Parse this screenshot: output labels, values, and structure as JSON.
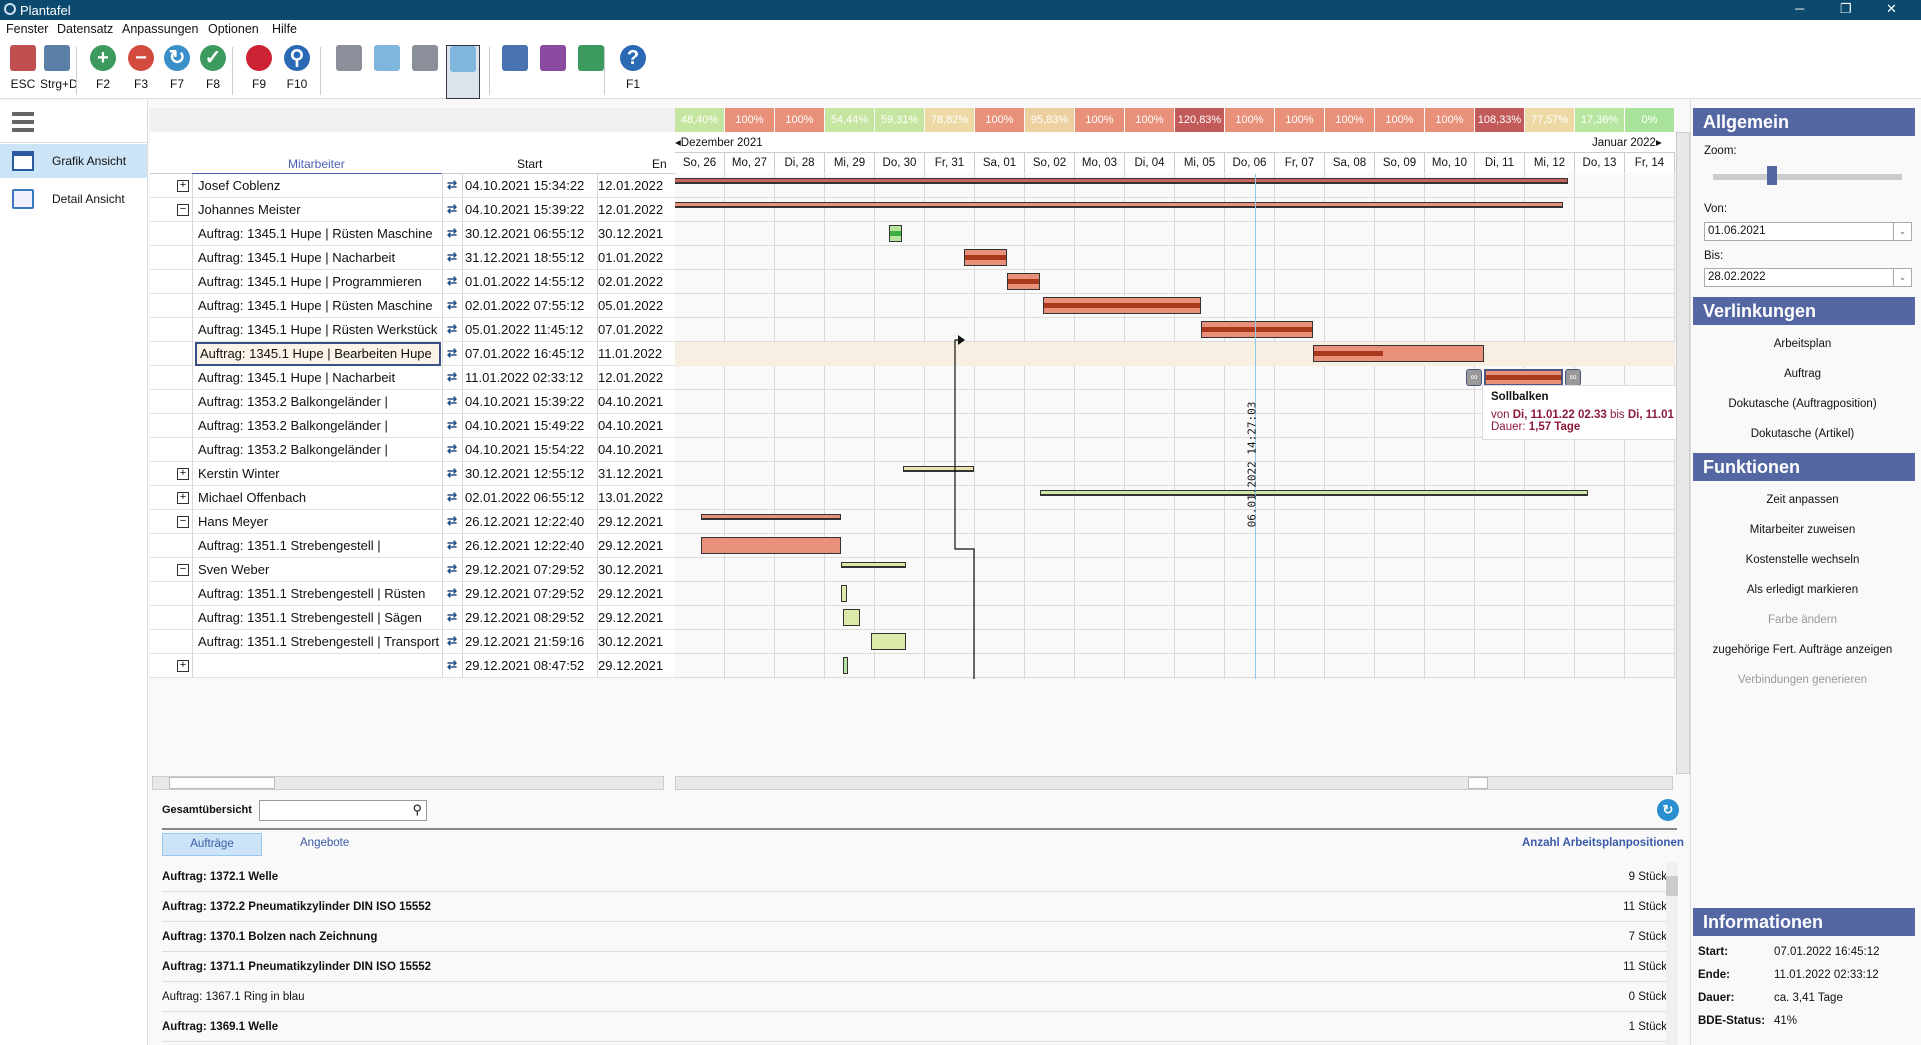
{
  "window": {
    "title": "Plantafel",
    "controls": [
      "─",
      "❐",
      "✕"
    ]
  },
  "menu": [
    "Fenster",
    "Datensatz",
    "Anpassungen",
    "Optionen",
    "Hilfe"
  ],
  "toolbar": [
    {
      "label": "ESC",
      "icon": "exit-icon",
      "color": "#c0504d"
    },
    {
      "label": "Strg+D",
      "icon": "print-icon",
      "color": "#5b7fa6"
    },
    {
      "label": "F2",
      "icon": "add-icon",
      "color": "#3c9a5f"
    },
    {
      "label": "F3",
      "icon": "remove-icon",
      "color": "#d24b3e"
    },
    {
      "label": "F7",
      "icon": "refresh-icon",
      "color": "#3a8fc9"
    },
    {
      "label": "F8",
      "icon": "check-icon",
      "color": "#3c9a5f"
    },
    {
      "label": "F9",
      "icon": "eraser-icon",
      "color": "#cc2233"
    },
    {
      "label": "F10",
      "icon": "search-icon",
      "color": "#2a6ab5"
    },
    {
      "label": "",
      "icon": "edit-plan-icon",
      "color": "#8a8f99"
    },
    {
      "label": "",
      "icon": "tools-icon",
      "color": "#7fb6dd"
    },
    {
      "label": "",
      "icon": "list-user-icon",
      "color": "#8a8f99"
    },
    {
      "label": "",
      "icon": "user-assign-icon",
      "color": "#7fb6dd"
    },
    {
      "label": "",
      "icon": "calendar-icon",
      "color": "#4a74b0"
    },
    {
      "label": "",
      "icon": "export-icon",
      "color": "#8a4aa0"
    },
    {
      "label": "",
      "icon": "import-icon",
      "color": "#3c9a5f"
    },
    {
      "label": "F1",
      "icon": "help-icon",
      "color": "#2a6ab5"
    }
  ],
  "sidebar": {
    "items": [
      {
        "label": "Grafik Ansicht",
        "active": true
      },
      {
        "label": "Detail Ansicht",
        "active": false
      }
    ]
  },
  "grid": {
    "headers": {
      "employee": "Mitarbeiter",
      "start": "Start",
      "end": "En"
    },
    "rows": [
      {
        "expand": "+",
        "name": "Josef Coblenz",
        "start": "04.10.2021 15:34:22",
        "end": "12.01.2022",
        "bar": {
          "type": "summary",
          "from": "2021-10-04T15:34",
          "to": "2022-01-12T20:40",
          "color": "#c8625a"
        }
      },
      {
        "expand": "-",
        "name": "Johannes Meister",
        "start": "04.10.2021 15:39:22",
        "end": "12.01.2022",
        "bar": {
          "type": "summary",
          "from": "2021-10-04T15:39",
          "to": "2022-01-12T18:15",
          "color": "#e8907a"
        }
      },
      {
        "expand": "",
        "name": "Auftrag: 1345.1 Hupe | Rüsten Maschine",
        "start": "30.12.2021 06:55:12",
        "end": "30.12.2021",
        "bar": {
          "type": "task",
          "from": "2021-12-30T06:55",
          "to": "2021-12-30T13:00",
          "color": "#b8e6a0",
          "progress": 1,
          "progcolor": "#3cb043"
        }
      },
      {
        "expand": "",
        "name": "Auftrag: 1345.1 Hupe | Nacharbeit",
        "start": "31.12.2021 18:55:12",
        "end": "01.01.2022",
        "bar": {
          "type": "task",
          "from": "2021-12-31T18:55",
          "to": "2022-01-01T15:20",
          "color": "#e8907a",
          "progress": 1
        }
      },
      {
        "expand": "",
        "name": "Auftrag: 1345.1 Hupe | Programmieren",
        "start": "01.01.2022 14:55:12",
        "end": "02.01.2022",
        "bar": {
          "type": "task",
          "from": "2022-01-01T15:20",
          "to": "2022-01-02T07:10",
          "color": "#e8907a",
          "progress": 1
        }
      },
      {
        "expand": "",
        "name": "Auftrag: 1345.1 Hupe | Rüsten Maschine",
        "start": "02.01.2022 07:55:12",
        "end": "05.01.2022",
        "bar": {
          "type": "task",
          "from": "2022-01-02T08:30",
          "to": "2022-01-05T12:30",
          "color": "#e8907a",
          "progress": 1
        }
      },
      {
        "expand": "",
        "name": "Auftrag: 1345.1 Hupe | Rüsten Werkstück",
        "start": "05.01.2022 11:45:12",
        "end": "07.01.2022",
        "bar": {
          "type": "task",
          "from": "2022-01-05T12:30",
          "to": "2022-01-07T18:15",
          "color": "#e8907a",
          "progress": 1
        }
      },
      {
        "expand": "",
        "name": "Auftrag: 1345.1 Hupe | Bearbeiten Hupe",
        "start": "07.01.2022 16:45:12",
        "end": "11.01.2022",
        "selected": true,
        "bar": {
          "type": "task",
          "from": "2022-01-07T18:15",
          "to": "2022-01-11T04:20",
          "color": "#e8907a",
          "progress": 0.41
        }
      },
      {
        "expand": "",
        "name": "Auftrag: 1345.1 Hupe | Nacharbeit",
        "start": "11.01.2022 02:33:12",
        "end": "12.01.2022",
        "bar": {
          "type": "task",
          "from": "2022-01-11T04:20",
          "to": "2022-01-12T18:15",
          "color": "#e8907a",
          "progress": 1,
          "links": true
        }
      },
      {
        "expand": "",
        "name": "Auftrag: 1353.2 Balkongeländer |",
        "start": "04.10.2021 15:39:22",
        "end": "04.10.2021"
      },
      {
        "expand": "",
        "name": "Auftrag: 1353.2 Balkongeländer |",
        "start": "04.10.2021 15:49:22",
        "end": "04.10.2021"
      },
      {
        "expand": "",
        "name": "Auftrag: 1353.2 Balkongeländer |",
        "start": "04.10.2021 15:54:22",
        "end": "04.10.2021"
      },
      {
        "expand": "+",
        "name": "Kerstin Winter",
        "start": "30.12.2021 12:55:12",
        "end": "31.12.2021",
        "bar": {
          "type": "summary",
          "from": "2021-12-30T13:30",
          "to": "2021-12-31T23:30",
          "color": "#ece3b0"
        }
      },
      {
        "expand": "+",
        "name": "Michael Offenbach",
        "start": "02.01.2022 06:55:12",
        "end": "13.01.2022",
        "bar": {
          "type": "summary",
          "from": "2022-01-02T07:10",
          "to": "2022-01-13T06:15",
          "color": "#cde8a8"
        }
      },
      {
        "expand": "-",
        "name": "Hans Meyer",
        "start": "26.12.2021 12:22:40",
        "end": "29.12.2021",
        "bar": {
          "type": "summary",
          "from": "2021-12-26T12:30",
          "to": "2021-12-29T07:40",
          "color": "#e8907a"
        }
      },
      {
        "expand": "",
        "name": "Auftrag: 1351.1 Strebengestell |",
        "start": "26.12.2021 12:22:40",
        "end": "29.12.2021",
        "bar": {
          "type": "task",
          "from": "2021-12-26T12:30",
          "to": "2021-12-29T07:40",
          "color": "#e8907a",
          "progress": 0
        }
      },
      {
        "expand": "-",
        "name": "Sven Weber",
        "start": "29.12.2021 07:29:52",
        "end": "30.12.2021",
        "bar": {
          "type": "summary",
          "from": "2021-12-29T07:40",
          "to": "2021-12-30T14:50",
          "color": "#dbeaa8"
        }
      },
      {
        "expand": "",
        "name": "Auftrag: 1351.1 Strebengestell | Rüsten",
        "start": "29.12.2021 07:29:52",
        "end": "29.12.2021",
        "bar": {
          "type": "task",
          "from": "2021-12-29T07:40",
          "to": "2021-12-29T10:30",
          "color": "#dbeaa8",
          "progress": 0
        }
      },
      {
        "expand": "",
        "name": "Auftrag: 1351.1 Strebengestell | Sägen",
        "start": "29.12.2021 08:29:52",
        "end": "29.12.2021",
        "bar": {
          "type": "task",
          "from": "2021-12-29T08:40",
          "to": "2021-12-29T16:40",
          "color": "#dbeaa8",
          "progress": 0
        }
      },
      {
        "expand": "",
        "name": "Auftrag: 1351.1 Strebengestell | Transport",
        "start": "29.12.2021 21:59:16",
        "end": "30.12.2021",
        "bar": {
          "type": "task",
          "from": "2021-12-29T22:00",
          "to": "2021-12-30T14:50",
          "color": "#dbeaa8",
          "progress": 0
        }
      },
      {
        "expand": "+",
        "name": "",
        "start": "29.12.2021 08:47:52",
        "end": "29.12.2021",
        "bar": {
          "type": "task",
          "from": "2021-12-29T08:50",
          "to": "2021-12-29T11:00",
          "color": "#b8e6a0",
          "progress": 0
        }
      }
    ]
  },
  "chart_data": {
    "type": "gantt",
    "first_day": "2021-12-26",
    "months": {
      "left": "Dezember 2021",
      "right": "Januar 2022"
    },
    "days": [
      "So, 26",
      "Mo, 27",
      "Di, 28",
      "Mi, 29",
      "Do, 30",
      "Fr, 31",
      "Sa, 01",
      "So, 02",
      "Mo, 03",
      "Di, 04",
      "Mi, 05",
      "Do, 06",
      "Fr, 07",
      "Sa, 08",
      "So, 09",
      "Mo, 10",
      "Di, 11",
      "Mi, 12",
      "Do, 13",
      "Fr, 14"
    ],
    "utilization": [
      {
        "v": "48,40%",
        "c": "#c6e5a0"
      },
      {
        "v": "100%",
        "c": "#e8907a"
      },
      {
        "v": "100%",
        "c": "#e8907a"
      },
      {
        "v": "54,44%",
        "c": "#c6e5a0"
      },
      {
        "v": "59,31%",
        "c": "#c6e5a0"
      },
      {
        "v": "78,82%",
        "c": "#ecd9a3"
      },
      {
        "v": "100%",
        "c": "#e8907a"
      },
      {
        "v": "95,83%",
        "c": "#ecd0a0"
      },
      {
        "v": "100%",
        "c": "#e8907a"
      },
      {
        "v": "100%",
        "c": "#e8907a"
      },
      {
        "v": "120,83%",
        "c": "#c25a5a"
      },
      {
        "v": "100%",
        "c": "#e8907a"
      },
      {
        "v": "100%",
        "c": "#e8907a"
      },
      {
        "v": "100%",
        "c": "#e8907a"
      },
      {
        "v": "100%",
        "c": "#e8907a"
      },
      {
        "v": "100%",
        "c": "#e8907a"
      },
      {
        "v": "108,33%",
        "c": "#c25a5a"
      },
      {
        "v": "77,57%",
        "c": "#ecd9a3"
      },
      {
        "v": "17,36%",
        "c": "#b8e6a0"
      },
      {
        "v": "0%",
        "c": "#a9e29b"
      }
    ],
    "now_marker": {
      "at": "2022-01-06T14:27",
      "label": "06.01.2022 14:27:03"
    },
    "tooltip": {
      "title": "Sollbalken",
      "from_prefix": "von",
      "from": "Di, 11.01.22 02.33",
      "to_prefix": "bis",
      "to": "Di, 11.01",
      "duration_label": "Dauer:",
      "duration": "1,57 Tage"
    }
  },
  "bottom": {
    "overview_label": "Gesamtübersicht",
    "search_value": "",
    "tabs": [
      "Aufträge",
      "Angebote"
    ],
    "count_header": "Anzahl Arbeitsplanpositionen",
    "items": [
      {
        "name": "Auftrag: 1372.1 Welle",
        "qty": "9 Stück",
        "bold": true
      },
      {
        "name": "Auftrag: 1372.2 Pneumatikzylinder DIN ISO 15552",
        "qty": "11 Stück",
        "bold": true
      },
      {
        "name": "Auftrag: 1370.1 Bolzen nach Zeichnung",
        "qty": "7 Stück",
        "bold": true
      },
      {
        "name": "Auftrag: 1371.1 Pneumatikzylinder DIN ISO 15552",
        "qty": "11 Stück",
        "bold": true
      },
      {
        "name": "Auftrag: 1367.1 Ring in blau",
        "qty": "0 Stück",
        "bold": false
      },
      {
        "name": "Auftrag: 1369.1 Welle",
        "qty": "1 Stück",
        "bold": true
      }
    ]
  },
  "panel": {
    "general": {
      "title": "Allgemein",
      "zoom_label": "Zoom:",
      "zoom_value": 0.3,
      "from_label": "Von:",
      "from": "01.06.2021",
      "to_label": "Bis:",
      "to": "28.02.2022"
    },
    "links": {
      "title": "Verlinkungen",
      "items": [
        {
          "label": "Arbeitsplan",
          "enabled": true
        },
        {
          "label": "Auftrag",
          "enabled": true
        },
        {
          "label": "Dokutasche (Auftragposition)",
          "enabled": true
        },
        {
          "label": "Dokutasche (Artikel)",
          "enabled": true
        }
      ]
    },
    "functions": {
      "title": "Funktionen",
      "items": [
        {
          "label": "Zeit anpassen",
          "enabled": true
        },
        {
          "label": "Mitarbeiter zuweisen",
          "enabled": true
        },
        {
          "label": "Kostenstelle wechseln",
          "enabled": true
        },
        {
          "label": "Als erledigt markieren",
          "enabled": true
        },
        {
          "label": "Farbe ändern",
          "enabled": false
        },
        {
          "label": "zugehörige Fert. Aufträge anzeigen",
          "enabled": true
        },
        {
          "label": "Verbindungen generieren",
          "enabled": false
        }
      ]
    },
    "info": {
      "title": "Informationen",
      "rows": [
        {
          "k": "Start:",
          "v": "07.01.2022 16:45:12"
        },
        {
          "k": "Ende:",
          "v": "11.01.2022 02:33:12"
        },
        {
          "k": "Dauer:",
          "v": "ca. 3,41 Tage"
        },
        {
          "k": "BDE-Status:",
          "v": "41%"
        }
      ]
    }
  }
}
